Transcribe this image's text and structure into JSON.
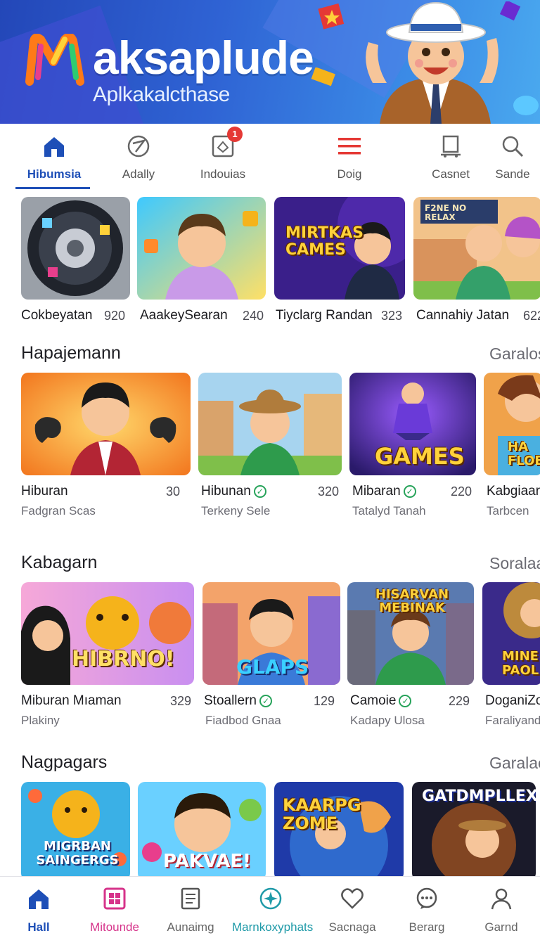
{
  "header": {
    "title": "aksaplude",
    "subtitle": "Aplkakalcthase"
  },
  "topnav": {
    "tabs": [
      {
        "label": "Hibumsia",
        "icon": "home-icon",
        "active": true
      },
      {
        "label": "Adally",
        "icon": "compass-icon"
      },
      {
        "label": "Indouias",
        "icon": "notification-icon",
        "badge": "1"
      },
      {
        "label": "Doig",
        "icon": "menu-icon"
      },
      {
        "label": "Casnet",
        "icon": "cart-icon"
      },
      {
        "label": "Sande",
        "icon": "search-icon"
      }
    ]
  },
  "row1": {
    "cards": [
      {
        "name": "Cokbeyatan",
        "count": "920"
      },
      {
        "name": "AaakeySearan",
        "count": "240"
      },
      {
        "name": "Tiyclarg Randan",
        "count": "323",
        "thumb_text": "MIRTKAS CAMES"
      },
      {
        "name": "Cannahiy Jatan",
        "count": "622",
        "thumb_text": "F2NE NO RELAX"
      }
    ]
  },
  "section1": {
    "title": "Hapajemann",
    "more": "Garalos",
    "cards": [
      {
        "name": "Hiburan",
        "count": "30",
        "sub": "Fadgran Scas"
      },
      {
        "name": "Hibunan",
        "count": "320",
        "sub": "Terkeny Sele",
        "verified": true
      },
      {
        "name": "Mibaran",
        "count": "220",
        "sub": "Tatalyd Tanah",
        "verified": true,
        "thumb_text": "GAMES"
      },
      {
        "name": "Kabgiaar",
        "sub": "Tarbcen",
        "thumb_text": "HA FLOE"
      }
    ]
  },
  "section2": {
    "title": "Kabagarn",
    "more": "Soralaa",
    "cards": [
      {
        "name": "Miburan Mıaman",
        "count": "329",
        "sub": "Plakiny",
        "thumb_text": "HIBRNO!"
      },
      {
        "name": "Stoallern",
        "count": "129",
        "sub": "Fiadbod Gnaa",
        "verified": true,
        "thumb_text": "GLAPS"
      },
      {
        "name": "Camoie",
        "count": "229",
        "sub": "Kadapy Ulosa",
        "verified": true,
        "thumb_text": "HISARVAN MEBINAK"
      },
      {
        "name": "DoganiZo",
        "sub": "Faraliyand",
        "thumb_text": "MINE PAOL"
      }
    ]
  },
  "section3": {
    "title": "Nagpagars",
    "more": "Garalae",
    "cards": [
      {
        "thumb_text": "MIGRBAN SAINGERGS"
      },
      {
        "thumb_text": "PAKVAE!"
      },
      {
        "thumb_text": "KAARPG ZOME"
      },
      {
        "thumb_text": "GATDMPLLEX"
      }
    ]
  },
  "bottomnav": {
    "items": [
      {
        "label": "Hall",
        "icon": "home-icon",
        "color": "#1e4fb7"
      },
      {
        "label": "Mitounde",
        "icon": "grid-icon",
        "color": "#d6338a"
      },
      {
        "label": "Aunaimg",
        "icon": "document-icon",
        "color": "#555555"
      },
      {
        "label": "Marnkoxyphats",
        "icon": "compass-icon",
        "color": "#1f9aa8"
      },
      {
        "label": "Sacnaga",
        "icon": "heart-icon",
        "color": "#555555"
      },
      {
        "label": "Berarg",
        "icon": "chat-icon",
        "color": "#555555"
      },
      {
        "label": "Garnd",
        "icon": "user-icon",
        "color": "#555555"
      }
    ]
  },
  "colors": {
    "accent": "#1e4fb7",
    "verified": "#27a35a",
    "badge": "#e53935",
    "banner": "#2f63d4"
  }
}
